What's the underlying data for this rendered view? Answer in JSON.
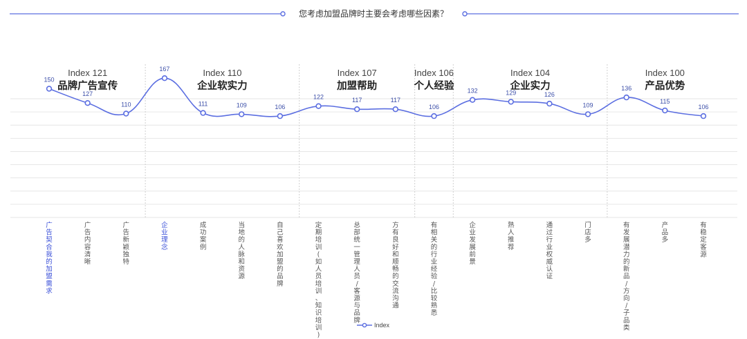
{
  "title": "您考虑加盟品牌时主要会考虑哪些因素？",
  "chart_data": {
    "type": "line",
    "ylim": [
      0,
      180
    ],
    "grid": true,
    "legend_position": "bottom-center",
    "series": [
      {
        "name": "Index",
        "color": "#5b6ee1"
      }
    ],
    "groups": [
      {
        "index_label": "Index 121",
        "name": "品牌广告宣传"
      },
      {
        "index_label": "Index 110",
        "name": "企业软实力"
      },
      {
        "index_label": "Index 107",
        "name": "加盟帮助"
      },
      {
        "index_label": "Index 106",
        "name": "个人经验"
      },
      {
        "index_label": "Index 104",
        "name": "企业实力"
      },
      {
        "index_label": "Index 100",
        "name": "产品优势"
      }
    ],
    "points": [
      {
        "category": "广告契合我的加盟需求",
        "value": 150,
        "group": 0,
        "highlight": true
      },
      {
        "category": "广告内容清晰",
        "value": 127,
        "group": 0
      },
      {
        "category": "广告新颖独特",
        "value": 110,
        "group": 0
      },
      {
        "category": "企业理念",
        "value": 167,
        "group": 1,
        "highlight": true
      },
      {
        "category": "成功案例",
        "value": 111,
        "group": 1
      },
      {
        "category": "当地的人脉和资源",
        "value": 109,
        "group": 1
      },
      {
        "category": "自己喜欢加盟的品牌",
        "value": 106,
        "group": 1
      },
      {
        "category": "定期培训(如人员培训、知识培训)",
        "value": 122,
        "group": 2
      },
      {
        "category": "总部统一管理人员/客源与品牌",
        "value": 117,
        "group": 2
      },
      {
        "category": "方有良好和顺畅的交流沟通",
        "value": 117,
        "group": 2
      },
      {
        "category": "有相关的行业经验/比较熟悉",
        "value": 106,
        "group": 3
      },
      {
        "category": "企业发展前景",
        "value": 132,
        "group": 4
      },
      {
        "category": "熟人推荐",
        "value": 129,
        "group": 4
      },
      {
        "category": "通过行业权威认证",
        "value": 126,
        "group": 4
      },
      {
        "category": "门店多",
        "value": 109,
        "group": 4
      },
      {
        "category": "有发展潜力的新品/方向/子品类",
        "value": 136,
        "group": 5
      },
      {
        "category": "产品多",
        "value": 115,
        "group": 5
      },
      {
        "category": "有稳定客源",
        "value": 106,
        "group": 5
      }
    ]
  }
}
